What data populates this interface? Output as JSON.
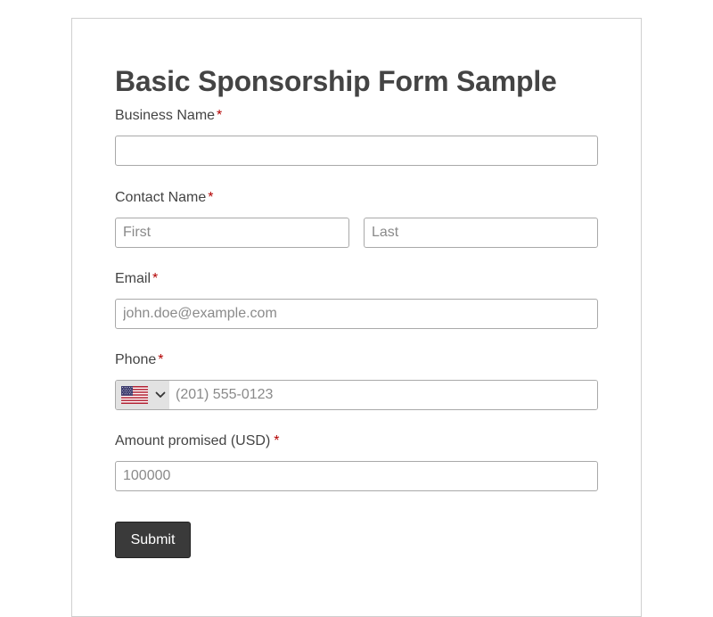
{
  "form": {
    "title": "Basic Sponsorship Form Sample",
    "required_mark": "*",
    "fields": {
      "business_name": {
        "label": "Business Name",
        "value": "",
        "placeholder": ""
      },
      "contact_name": {
        "label": "Contact Name",
        "first_placeholder": "First",
        "last_placeholder": "Last"
      },
      "email": {
        "label": "Email",
        "placeholder": "john.doe@example.com"
      },
      "phone": {
        "label": "Phone",
        "country_icon": "us-flag-icon",
        "placeholder": "(201) 555-0123"
      },
      "amount": {
        "label": "Amount promised (USD)",
        "placeholder": "100000"
      }
    },
    "submit_label": "Submit"
  },
  "colors": {
    "text": "#444444",
    "required": "#b30000",
    "border": "#a9a9a9",
    "card_border": "#cfcfcf",
    "button_bg": "#3a3a3a",
    "button_text": "#ffffff",
    "country_select_bg": "#e2e2e2"
  }
}
